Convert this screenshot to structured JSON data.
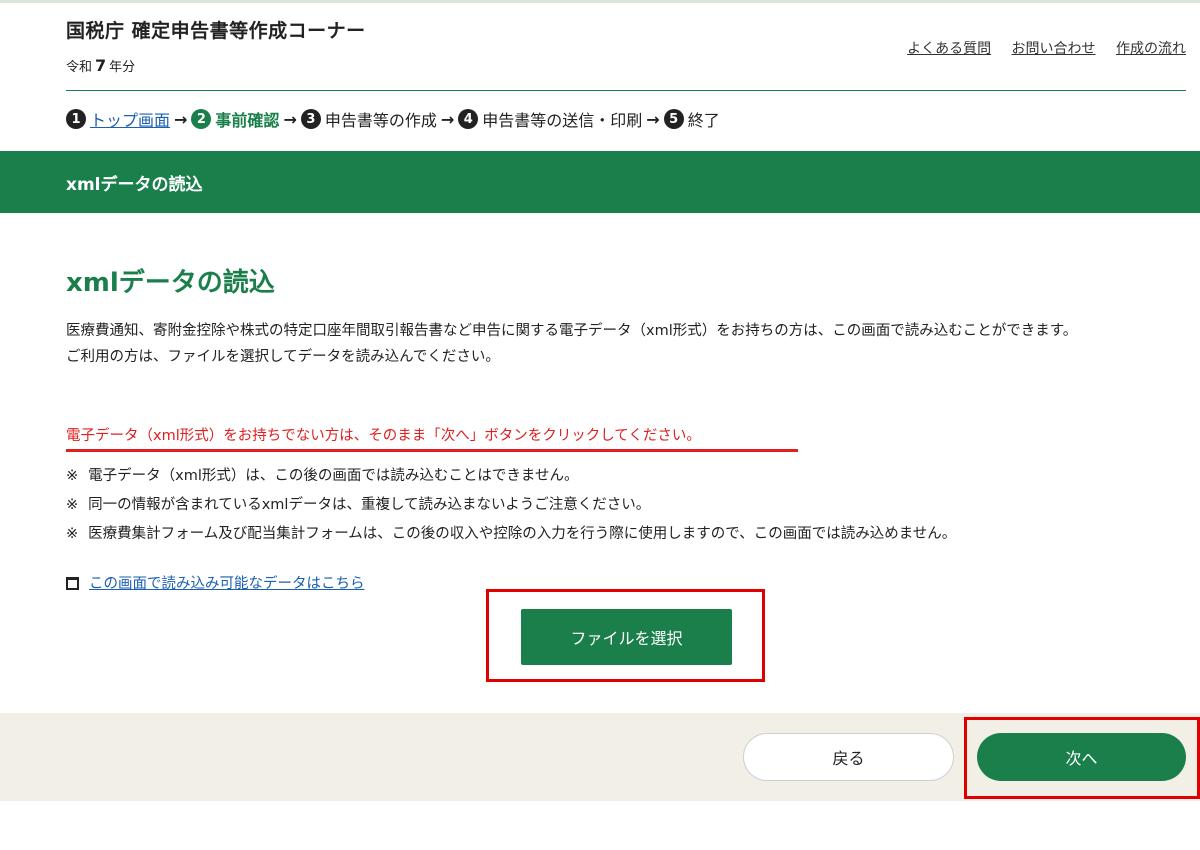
{
  "header": {
    "title": "国税庁 確定申告書等作成コーナー",
    "era_prefix": "令和",
    "era_year": "7",
    "era_suffix": "年分",
    "links": [
      "よくある質問",
      "お問い合わせ",
      "作成の流れ"
    ]
  },
  "steps": [
    {
      "num": "1",
      "label": "トップ画面",
      "state": "link"
    },
    {
      "num": "2",
      "label": "事前確認",
      "state": "active"
    },
    {
      "num": "3",
      "label": "申告書等の作成",
      "state": "inactive"
    },
    {
      "num": "4",
      "label": "申告書等の送信・印刷",
      "state": "inactive"
    },
    {
      "num": "5",
      "label": "終了",
      "state": "inactive"
    }
  ],
  "step_arrow": "→",
  "banner": {
    "title": "xmlデータの読込"
  },
  "main": {
    "title": "xmlデータの読込",
    "intro_lines": [
      "医療費通知、寄附金控除や株式の特定口座年間取引報告書など申告に関する電子データ（xml形式）をお持ちの方は、この画面で読み込むことができます。",
      "ご利用の方は、ファイルを選択してデータを読み込んでください。"
    ],
    "notice": "電子データ（xml形式）をお持ちでない方は、そのまま「次へ」ボタンをクリックしてください。",
    "note_mark": "※",
    "notes": [
      "電子データ（xml形式）は、この後の画面では読み込むことはできません。",
      "同一の情報が含まれているxmlデータは、重複して読み込まないようご注意ください。",
      "医療費集計フォーム及び配当集計フォームは、この後の収入や控除の入力を行う際に使用しますので、この画面では読み込めません。"
    ],
    "link_text": "この画面で読み込み可能なデータはこちら",
    "file_button": "ファイルを選択"
  },
  "footer": {
    "back": "戻る",
    "next": "次へ"
  },
  "colors": {
    "brand_green": "#1a7f4b",
    "alert_red": "#e02020",
    "link_blue": "#1a5fb4",
    "footer_bg": "#f1efe6"
  }
}
